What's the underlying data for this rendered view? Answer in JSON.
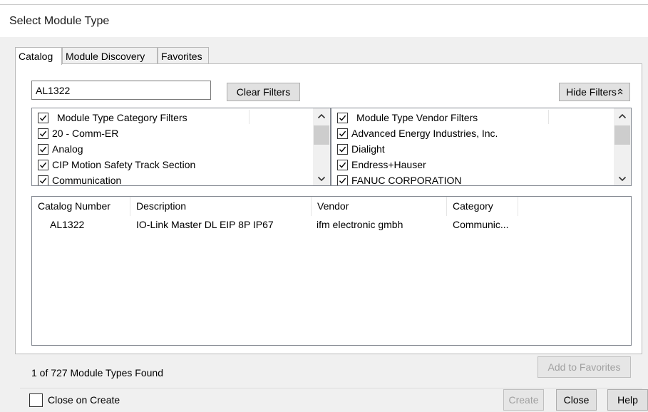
{
  "dialog": {
    "title": "Select Module Type"
  },
  "tabs": [
    {
      "label": "Catalog",
      "active": true
    },
    {
      "label": "Module Discovery",
      "active": false
    },
    {
      "label": "Favorites",
      "active": false
    }
  ],
  "search": {
    "value": "AL1322"
  },
  "buttons": {
    "clear_filters": "Clear Filters",
    "hide_filters": "Hide Filters",
    "add_to_favorites": "Add to Favorites",
    "create": "Create",
    "close": "Close",
    "help": "Help"
  },
  "category_filters": {
    "header": "Module Type Category Filters",
    "items": [
      {
        "label": "20 - Comm-ER",
        "checked": true
      },
      {
        "label": "Analog",
        "checked": true
      },
      {
        "label": "CIP Motion Safety Track Section",
        "checked": true
      },
      {
        "label": "Communication",
        "checked": true
      }
    ]
  },
  "vendor_filters": {
    "header": "Module Type Vendor Filters",
    "items": [
      {
        "label": "Advanced Energy Industries, Inc.",
        "checked": true
      },
      {
        "label": "Dialight",
        "checked": true
      },
      {
        "label": "Endress+Hauser",
        "checked": true
      },
      {
        "label": "FANUC CORPORATION",
        "checked": true
      }
    ]
  },
  "results_table": {
    "columns": [
      "Catalog Number",
      "Description",
      "Vendor",
      "Category"
    ],
    "rows": [
      [
        "AL1322",
        "IO-Link Master DL EIP 8P IP67",
        "ifm electronic gmbh",
        "Communic..."
      ]
    ]
  },
  "status": {
    "found_text": "1 of 727 Module Types Found"
  },
  "footer": {
    "close_on_create_label": "Close on Create",
    "close_on_create_checked": false
  },
  "icons": [
    "check-icon",
    "scroll-up-arrow-icon",
    "scroll-down-arrow-icon",
    "double-chevron-up-icon"
  ]
}
